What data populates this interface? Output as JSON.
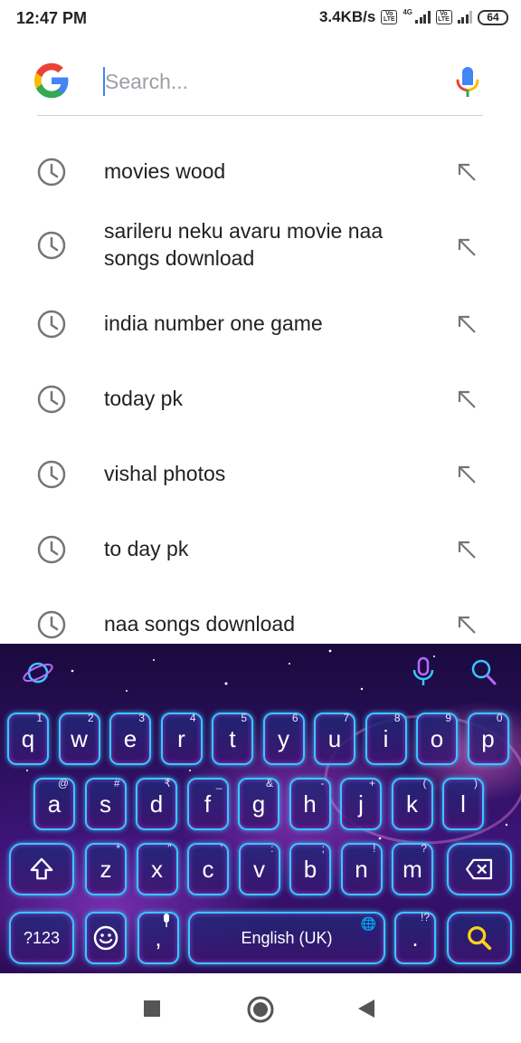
{
  "status_bar": {
    "time": "12:47 PM",
    "network_speed": "3.4KB/s",
    "volte_label": "Vo LTE",
    "network_type": "4G",
    "battery": "64"
  },
  "search": {
    "placeholder": "Search...",
    "value": "",
    "logo_icon": "google-g-icon",
    "mic_icon": "google-mic-icon"
  },
  "suggestions": [
    {
      "text": "movies wood"
    },
    {
      "text": "sarileru neku avaru movie naa songs download"
    },
    {
      "text": "india number one game"
    },
    {
      "text": "today pk"
    },
    {
      "text": "vishal photos"
    },
    {
      "text": "to day pk"
    },
    {
      "text": "naa songs download"
    }
  ],
  "keyboard": {
    "row1": [
      {
        "label": "q",
        "hint": "1"
      },
      {
        "label": "w",
        "hint": "2"
      },
      {
        "label": "e",
        "hint": "3"
      },
      {
        "label": "r",
        "hint": "4"
      },
      {
        "label": "t",
        "hint": "5"
      },
      {
        "label": "y",
        "hint": "6"
      },
      {
        "label": "u",
        "hint": "7"
      },
      {
        "label": "i",
        "hint": "8"
      },
      {
        "label": "o",
        "hint": "9"
      },
      {
        "label": "p",
        "hint": "0"
      }
    ],
    "row2": [
      {
        "label": "a",
        "hint": "@"
      },
      {
        "label": "s",
        "hint": "#"
      },
      {
        "label": "d",
        "hint": "₹"
      },
      {
        "label": "f",
        "hint": "_"
      },
      {
        "label": "g",
        "hint": "&"
      },
      {
        "label": "h",
        "hint": "-"
      },
      {
        "label": "j",
        "hint": "+"
      },
      {
        "label": "k",
        "hint": "("
      },
      {
        "label": "l",
        "hint": ")"
      }
    ],
    "row3": [
      {
        "label": "z",
        "hint": "*"
      },
      {
        "label": "x",
        "hint": "\""
      },
      {
        "label": "c",
        "hint": "'"
      },
      {
        "label": "v",
        "hint": ":"
      },
      {
        "label": "b",
        "hint": ";"
      },
      {
        "label": "n",
        "hint": "!"
      },
      {
        "label": "m",
        "hint": "?"
      }
    ],
    "symbols_label": "?123",
    "comma_label": ",",
    "period_label": ".",
    "period_hint": "!?",
    "space_label": "English (UK)",
    "accent_color": "#39c6ff",
    "search_key_color": "#ffd21a"
  },
  "nav_bar": {
    "recents_icon": "square-icon",
    "home_icon": "circle-icon",
    "back_icon": "triangle-back-icon"
  }
}
